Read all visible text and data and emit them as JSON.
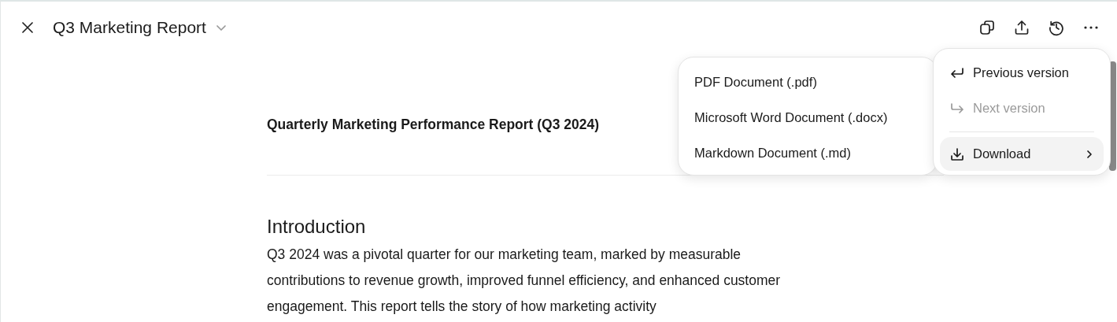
{
  "header": {
    "title": "Q3 Marketing Report"
  },
  "document": {
    "title": "Quarterly Marketing Performance Report (Q3 2024)",
    "sections": [
      {
        "heading": "Introduction",
        "paragraph": "Q3 2024 was a pivotal quarter for our marketing team, marked by measurable contributions to revenue growth, improved funnel efficiency, and enhanced customer engagement. This report tells the story of how marketing activity"
      }
    ]
  },
  "menu": {
    "items": [
      {
        "kind": "item",
        "label": "Previous version",
        "disabled": false,
        "highlighted": false
      },
      {
        "kind": "item",
        "label": "Next version",
        "disabled": true,
        "highlighted": false
      },
      {
        "kind": "separator"
      },
      {
        "kind": "submenu",
        "label": "Download",
        "disabled": false,
        "highlighted": true
      }
    ]
  },
  "submenu": {
    "items": [
      {
        "label": "PDF Document (.pdf)"
      },
      {
        "label": "Microsoft Word Document (.docx)"
      },
      {
        "label": "Markdown Document (.md)"
      }
    ]
  }
}
